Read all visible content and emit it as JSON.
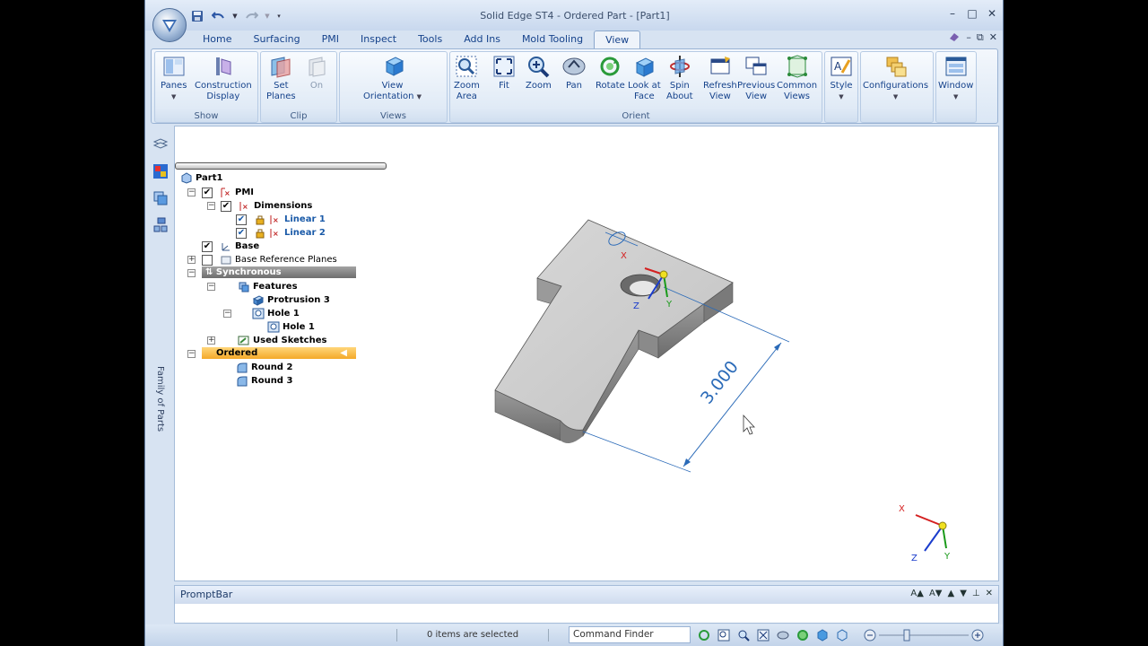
{
  "window": {
    "title": "Solid Edge ST4 - Ordered Part - [Part1]",
    "controls": {
      "minimize": "–",
      "maximize": "□",
      "close": "✕"
    }
  },
  "doc_controls": {
    "minimize": "–",
    "restore": "⧉",
    "close": "✕"
  },
  "tabs": [
    "Home",
    "Surfacing",
    "PMI",
    "Inspect",
    "Tools",
    "Add Ins",
    "Mold Tooling",
    "View"
  ],
  "ribbon": {
    "show": {
      "label": "Show",
      "panes": "Panes",
      "construction": "Construction",
      "display": "Display"
    },
    "clip": {
      "label": "Clip",
      "set": "Set",
      "planes": "Planes",
      "on": "On"
    },
    "views": {
      "label": "Views",
      "view": "View",
      "orientation": "Orientation"
    },
    "orient": {
      "label": "Orient",
      "zoom": "Zoom",
      "area": "Area",
      "fit": "Fit",
      "zoom2": "Zoom",
      "pan": "Pan",
      "rotate": "Rotate",
      "look_at": "Look at",
      "face": "Face",
      "spin": "Spin",
      "about": "About",
      "refresh": "Refresh",
      "view1": "View",
      "previous": "Previous",
      "view2": "View",
      "common": "Common",
      "views": "Views"
    },
    "style": "Style",
    "configurations": "Configurations",
    "window": "Window"
  },
  "side_strip": {
    "family_label": "Family of Parts"
  },
  "tree": {
    "root": "Part1",
    "pmi": "PMI",
    "dimensions": "Dimensions",
    "linear1": "Linear 1",
    "linear2": "Linear 2",
    "base": "Base",
    "base_ref": "Base Reference Planes",
    "synchronous": "Synchronous",
    "features": "Features",
    "protrusion3": "Protrusion 3",
    "hole1_group": "Hole 1",
    "hole1": "Hole 1",
    "used_sketches": "Used Sketches",
    "ordered": "Ordered",
    "round2": "Round 2",
    "round3": "Round 3"
  },
  "model": {
    "dimension_value": "3.000",
    "axes": {
      "x": "X",
      "y": "Y",
      "z": "Z"
    },
    "colors": {
      "x_axis": "#d42020",
      "y_axis": "#1a9a1a",
      "z_axis": "#1a3ccc",
      "dimension": "#2a6ab8"
    }
  },
  "promptbar": {
    "title": "PromptBar",
    "controls": [
      "A▲",
      "A▼",
      "▲",
      "▼",
      "⊥",
      "✕"
    ]
  },
  "status": {
    "selection": "0 items are selected",
    "command_finder": "Command Finder"
  }
}
